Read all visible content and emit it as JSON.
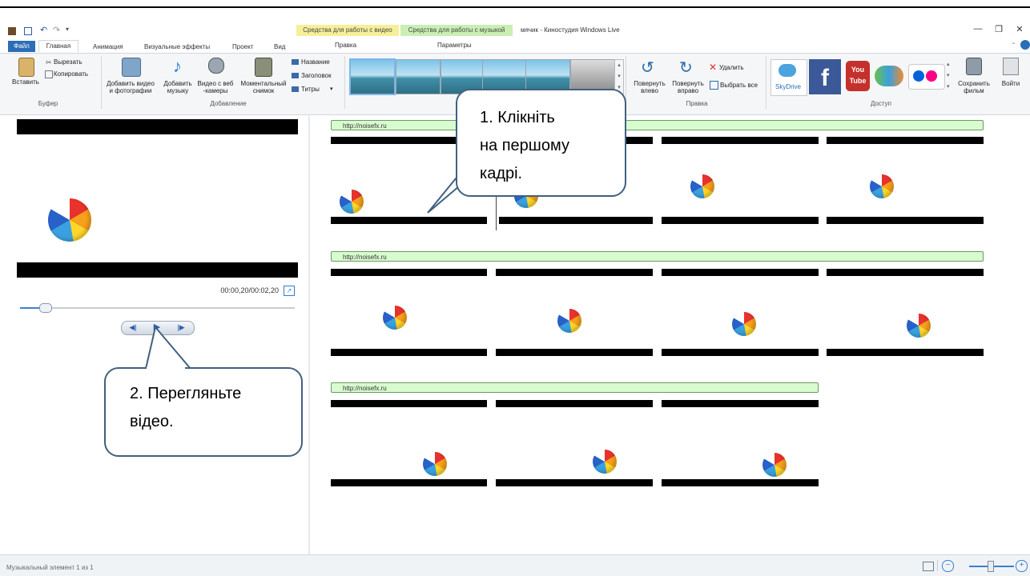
{
  "window": {
    "title": "мячик - Киностудия Windows Live",
    "controls": [
      "—",
      "❐",
      "✕"
    ]
  },
  "context_tabs": {
    "video": "Средства для работы с видео",
    "music": "Средства для работы с музыкой"
  },
  "tabs": [
    "Файл",
    "Главная",
    "Анимация",
    "Визуальные эффекты",
    "Проект",
    "Вид"
  ],
  "context_subtabs": [
    "Правка",
    "Параметры"
  ],
  "ribbon": {
    "groups": {
      "buffer": "Буфер",
      "add": "Добавление",
      "edit": "Правка",
      "share": "Доступ"
    },
    "paste": "Вставить",
    "cut": "Вырезать",
    "copy": "Копировать",
    "add_video": "Добавить видео и фотографии",
    "add_music": "Добавить музыку",
    "webcam": "Видео с веб -камеры",
    "snapshot": "Моментальный снимок",
    "name": "Название",
    "heading": "Заголовок",
    "titles": "Титры",
    "rotate_left": "Повернуть влево",
    "rotate_right": "Повернуть вправо",
    "delete": "Удалить",
    "select_all": "Выбрать все",
    "skydrive": "SkyDrive",
    "save_movie": "Сохранить фильм",
    "signin": "Войти"
  },
  "preview": {
    "timecode": "00:00,20/00:02,20",
    "progress": 0.09
  },
  "storyboard": {
    "music_label": "http://noisefx.ru"
  },
  "callouts": {
    "one": [
      "1. Клікніть",
      "на першому",
      "кадрі."
    ],
    "two": [
      "2. Перегляньте",
      "відео."
    ]
  },
  "status": {
    "text": "Музыкальный элемент 1 из 1",
    "zoom_level": 0.5
  },
  "colors": {
    "accent": "#2b6db6",
    "video_tools": "#f6ef9a",
    "music_tools": "#c9efb4",
    "music_clip": "#d9fbd0"
  }
}
